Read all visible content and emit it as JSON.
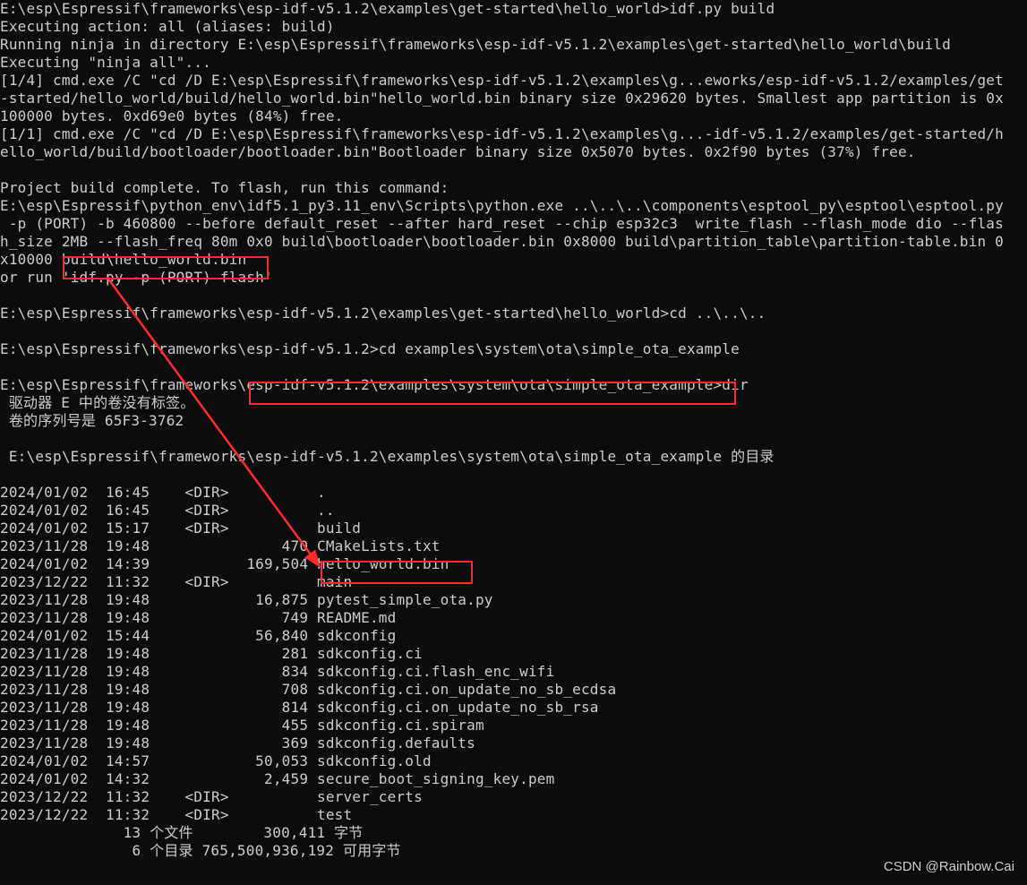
{
  "lines": {
    "l01": "E:\\esp\\Espressif\\frameworks\\esp-idf-v5.1.2\\examples\\get-started\\hello_world>idf.py build",
    "l02": "Executing action: all (aliases: build)",
    "l03": "Running ninja in directory E:\\esp\\Espressif\\frameworks\\esp-idf-v5.1.2\\examples\\get-started\\hello_world\\build",
    "l04": "Executing \"ninja all\"...",
    "l05": "[1/4] cmd.exe /C \"cd /D E:\\esp\\Espressif\\frameworks\\esp-idf-v5.1.2\\examples\\g...eworks/esp-idf-v5.1.2/examples/get",
    "l06": "-started/hello_world/build/hello_world.bin\"hello_world.bin binary size 0x29620 bytes. Smallest app partition is 0x",
    "l07": "100000 bytes. 0xd69e0 bytes (84%) free.",
    "l08": "[1/1] cmd.exe /C \"cd /D E:\\esp\\Espressif\\frameworks\\esp-idf-v5.1.2\\examples\\g...-idf-v5.1.2/examples/get-started/h",
    "l09": "ello_world/build/bootloader/bootloader.bin\"Bootloader binary size 0x5070 bytes. 0x2f90 bytes (37%) free.",
    "l10": "",
    "l11": "Project build complete. To flash, run this command:",
    "l12": "E:\\esp\\Espressif\\python_env\\idf5.1_py3.11_env\\Scripts\\python.exe ..\\..\\..\\components\\esptool_py\\esptool\\esptool.py",
    "l13": " -p (PORT) -b 460800 --before default_reset --after hard_reset --chip esp32c3  write_flash --flash_mode dio --flas",
    "l14": "h_size 2MB --flash_freq 80m 0x0 build\\bootloader\\bootloader.bin 0x8000 build\\partition_table\\partition-table.bin 0",
    "l15": "x10000 build\\hello_world.bin",
    "l16": "or run 'idf.py -p (PORT) flash'",
    "l17": "",
    "l18": "E:\\esp\\Espressif\\frameworks\\esp-idf-v5.1.2\\examples\\get-started\\hello_world>cd ..\\..\\..",
    "l19": "",
    "l20": "E:\\esp\\Espressif\\frameworks\\esp-idf-v5.1.2>cd examples\\system\\ota\\simple_ota_example",
    "l21": "",
    "l22": "E:\\esp\\Espressif\\frameworks\\esp-idf-v5.1.2\\examples\\system\\ota\\simple_ota_example>dir",
    "l23": " 驱动器 E 中的卷没有标签。",
    "l24": " 卷的序列号是 65F3-3762",
    "l25": "",
    "l26": " E:\\esp\\Espressif\\frameworks\\esp-idf-v5.1.2\\examples\\system\\ota\\simple_ota_example 的目录",
    "l27": "",
    "l28": "2024/01/02  16:45    <DIR>          .",
    "l29": "2024/01/02  16:45    <DIR>          ..",
    "l30": "2024/01/02  15:17    <DIR>          build",
    "l31": "2023/11/28  19:48               470 CMakeLists.txt",
    "l32": "2024/01/02  14:39           169,504 hello_world.bin",
    "l33": "2023/12/22  11:32    <DIR>          main",
    "l34": "2023/11/28  19:48            16,875 pytest_simple_ota.py",
    "l35": "2023/11/28  19:48               749 README.md",
    "l36": "2024/01/02  15:44            56,840 sdkconfig",
    "l37": "2023/11/28  19:48               281 sdkconfig.ci",
    "l38": "2023/11/28  19:48               834 sdkconfig.ci.flash_enc_wifi",
    "l39": "2023/11/28  19:48               708 sdkconfig.ci.on_update_no_sb_ecdsa",
    "l40": "2023/11/28  19:48               814 sdkconfig.ci.on_update_no_sb_rsa",
    "l41": "2023/11/28  19:48               455 sdkconfig.ci.spiram",
    "l42": "2023/11/28  19:48               369 sdkconfig.defaults",
    "l43": "2024/01/02  14:57            50,053 sdkconfig.old",
    "l44": "2024/01/02  14:32             2,459 secure_boot_signing_key.pem",
    "l45": "2023/12/22  11:32    <DIR>          server_certs",
    "l46": "2023/12/22  11:32    <DIR>          test",
    "l47": "              13 个文件        300,411 字节",
    "l48": "               6 个目录 765,500,936,192 可用字节"
  },
  "watermark": "CSDN @Rainbow.Cai",
  "annotations": {
    "box1": "build\\hello_world.bin",
    "box2": "esp-idf-v5.1.2\\examples\\system\\ota\\simple_ota_example",
    "box3": "hello_world.bin"
  }
}
